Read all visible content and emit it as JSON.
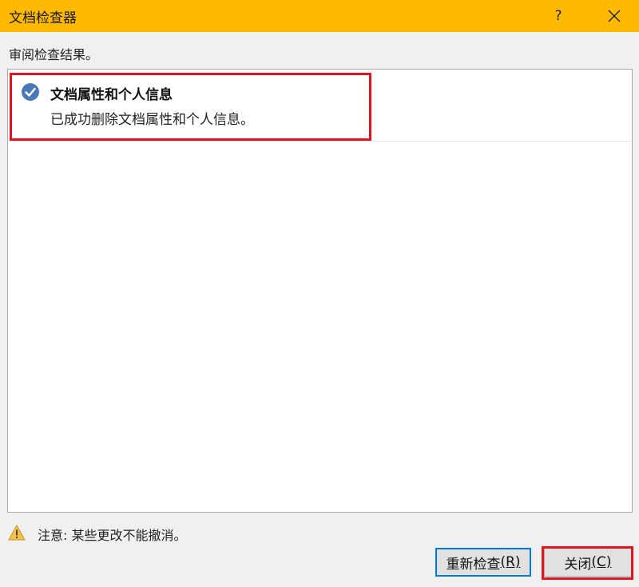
{
  "window": {
    "title": "文档检查器",
    "help_label": "?",
    "icons": {
      "close": "close-icon"
    }
  },
  "instruction": "审阅检查结果。",
  "results": [
    {
      "title": "文档属性和个人信息",
      "detail": "已成功删除文档属性和个人信息。",
      "status_icon": "check-circle-icon",
      "status_color": "#4a7ab5"
    }
  ],
  "warning": {
    "icon": "warning-icon",
    "text": "注意: 某些更改不能撤消。"
  },
  "buttons": {
    "reinspect": {
      "label": "重新检查",
      "accel": "(R)"
    },
    "close": {
      "label": "关闭",
      "accel": "(C)"
    }
  },
  "colors": {
    "titlebar": "#ffb900",
    "highlight": "#e0141e",
    "focus": "#0078d7"
  }
}
